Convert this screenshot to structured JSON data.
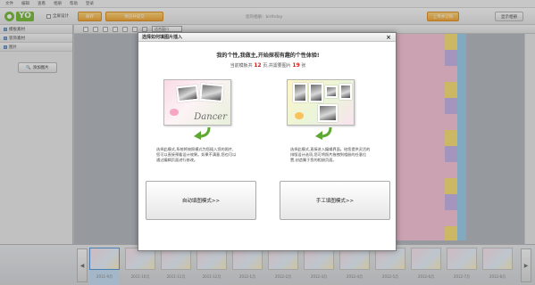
{
  "menu": [
    "文件",
    "编辑",
    "查看",
    "相册",
    "帮助",
    "登录"
  ],
  "toolbar": {
    "logo_text": "YO",
    "checkbox_label": "全屏设计",
    "save_label": "保存",
    "preview_label": "预览并提交",
    "status_text": "您的相册：birthday",
    "right_button_1": "上传并订购",
    "right_button_2": "显示相册"
  },
  "left_panel": {
    "items": [
      "模板素材",
      "装饰素材",
      "图片"
    ],
    "add_photo_label": "添加图片"
  },
  "canvas_tools": {
    "combo_value": "适合窗口"
  },
  "dialog": {
    "title": "选择如何填图片插入",
    "close_icon": "×",
    "headline": "我的个性,我做主,开始探视有趣的个性体验!",
    "sub_prefix": "当前模板共",
    "pages": "12",
    "sub_mid": "页,共需要图片",
    "photos": "19",
    "sub_suffix": "张",
    "auto_card_text": "Dancer",
    "auto_desc": "选择此模式,系统将按照模式为您插入您的照片,您可以直接预看设计效果。如果不满意,您也可以通过编辑页面进行修改。",
    "manual_desc": "选择此模式,直接进入编辑界面。给您提供灵活的排版设计选项,您可将照片拖拽到相册的任意位置,创造属于您的相册页面。",
    "auto_button": "自动填图模式>>",
    "manual_button": "手工填图模式>>"
  },
  "filmstrip": {
    "captions": [
      "2011-9月",
      "2011-10月",
      "2011-11月",
      "2011-12月",
      "2012-1月",
      "2012-2月",
      "2012-3月",
      "2012-4月",
      "2012-5月",
      "2012-6月",
      "2012-7月",
      "2012-8月"
    ]
  },
  "colors": {
    "accent_orange": "#f2a93b",
    "logo_green": "#7dbd42",
    "highlight_red": "#d62020"
  }
}
